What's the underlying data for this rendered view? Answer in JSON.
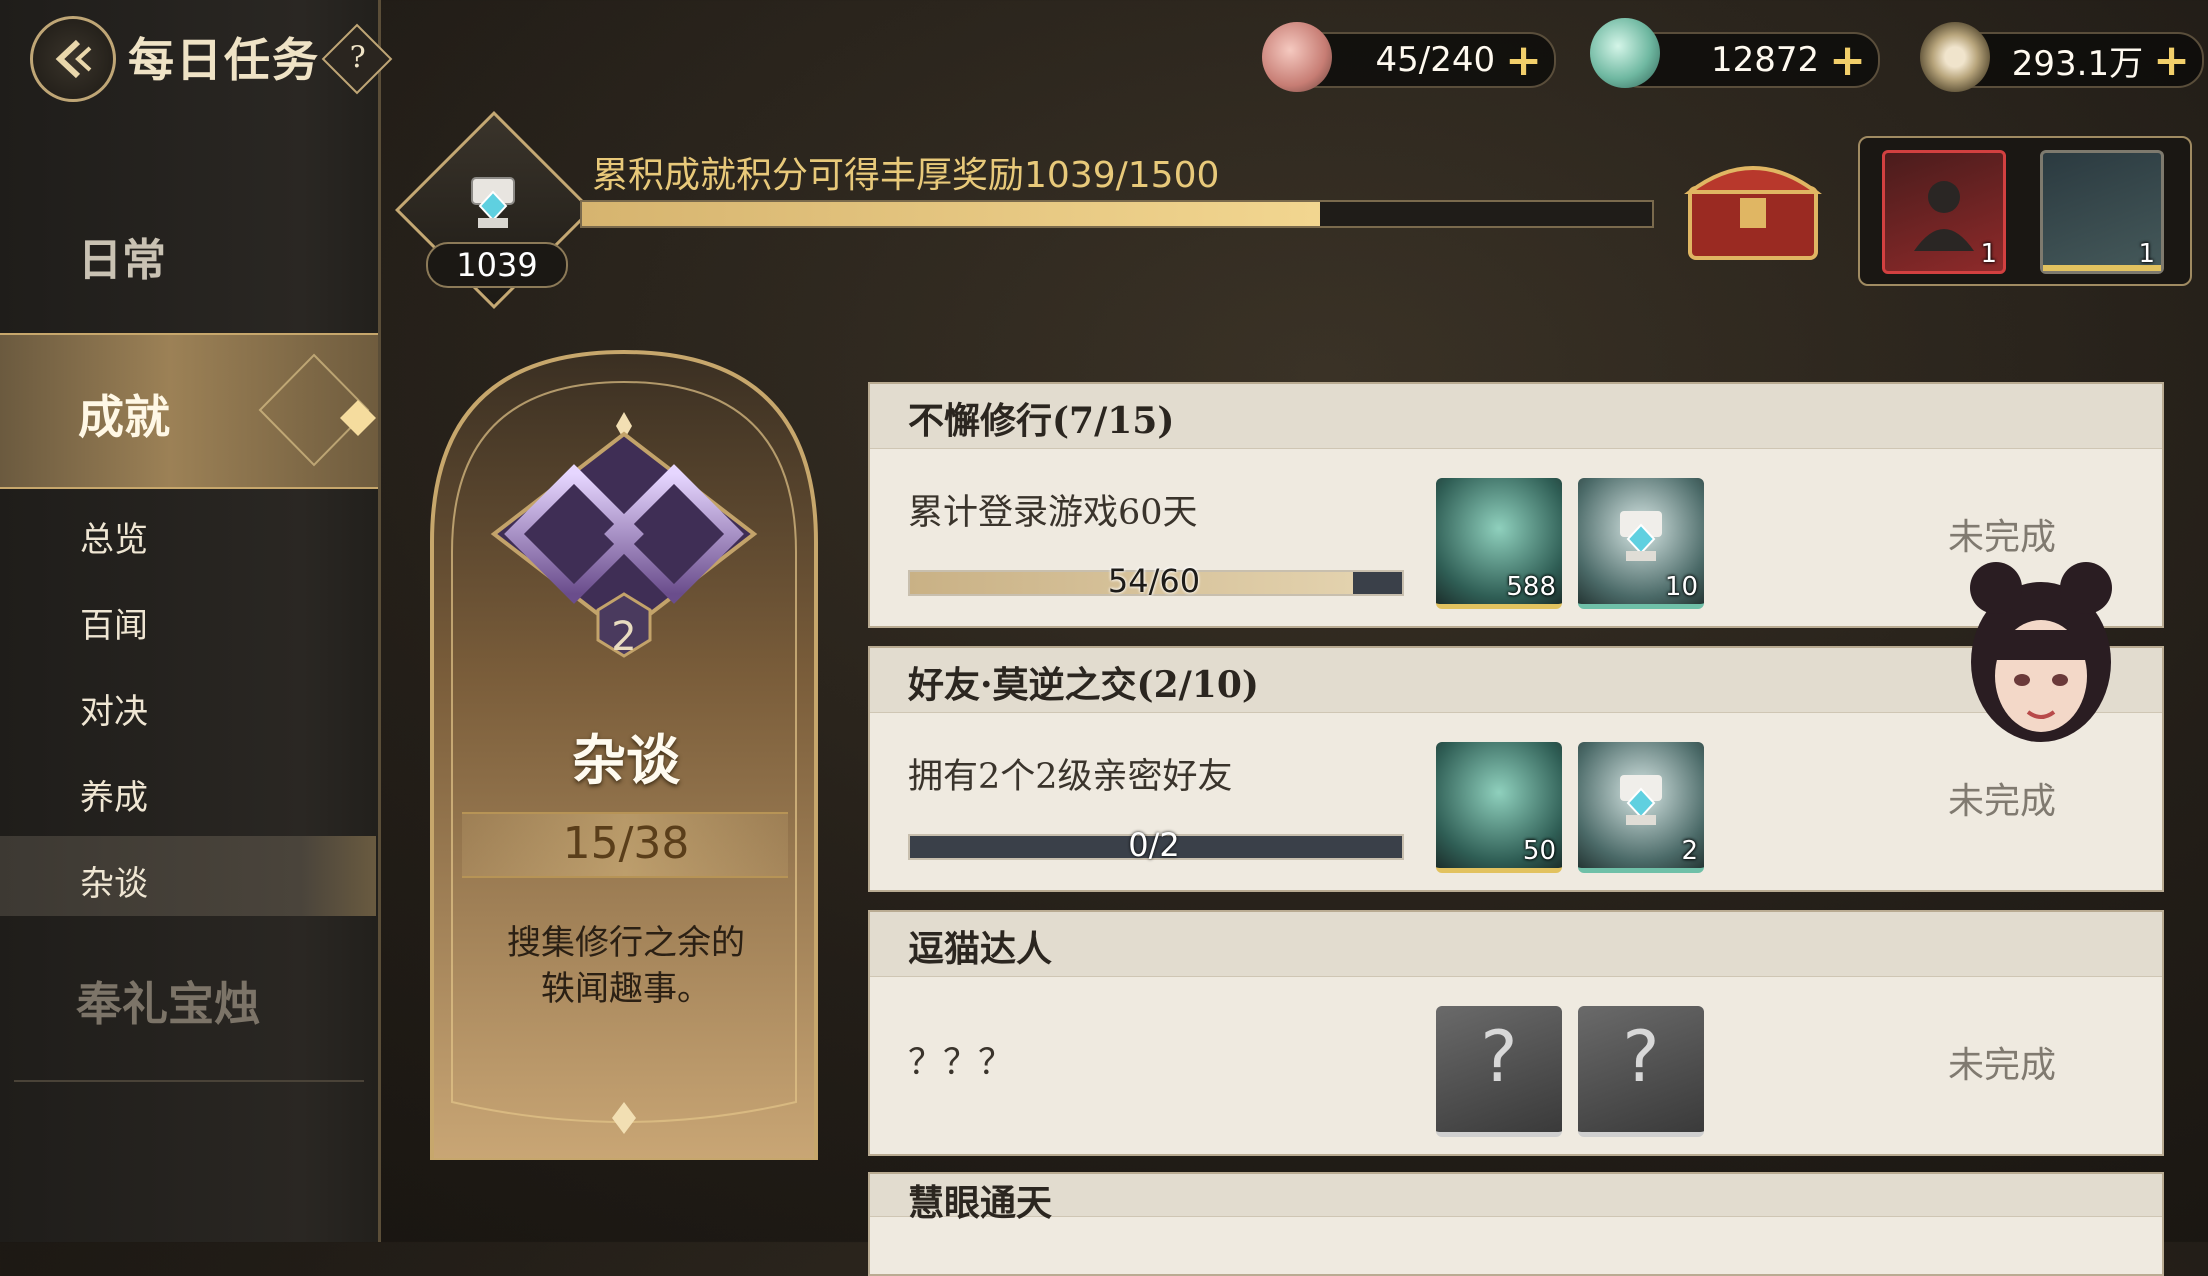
{
  "header": {
    "back_icon": "back-arrow-icon",
    "title": "每日任务",
    "help": "?"
  },
  "resources": [
    {
      "icon": "peach-stamina-icon",
      "value": "45/240",
      "plus": "+"
    },
    {
      "icon": "jade-lotus-icon",
      "value": "12872",
      "plus": "+"
    },
    {
      "icon": "gear-coin-icon",
      "value": "293.1万",
      "plus": "+"
    }
  ],
  "sidebar": {
    "category_daily": "日常",
    "category_achievement": "成就",
    "items": [
      {
        "label": "总览"
      },
      {
        "label": "百闻"
      },
      {
        "label": "对决"
      },
      {
        "label": "养成"
      },
      {
        "label": "杂谈"
      }
    ],
    "active_item": "杂谈",
    "category_gift": "奉礼宝烛"
  },
  "achievement_progress": {
    "score": "1039",
    "title_text": "累积成就积分可得丰厚奖励",
    "title_count": "1039/1500",
    "fraction": 0.69,
    "rewards": [
      {
        "icon": "portrait-frame-icon",
        "count": "1"
      },
      {
        "icon": "banner-card-icon",
        "count": "1"
      }
    ]
  },
  "category_card": {
    "level": "2",
    "name": "杂谈",
    "progress": "15/38",
    "description_line1": "搜集修行之余的",
    "description_line2": "轶闻趣事。"
  },
  "achievements": [
    {
      "title": "不懈修行(7/15)",
      "description": "累计登录游戏60天",
      "progress_text": "54/60",
      "progress_fraction": 0.9,
      "rewards": [
        {
          "icon": "jade-lotus-icon",
          "count": "588"
        },
        {
          "icon": "trophy-cup-icon",
          "count": "10"
        }
      ],
      "status": "未完成"
    },
    {
      "title": "好友·莫逆之交(2/10)",
      "description": "拥有2个2级亲密好友",
      "progress_text": "0/2",
      "progress_fraction": 0,
      "rewards": [
        {
          "icon": "jade-lotus-icon",
          "count": "50"
        },
        {
          "icon": "trophy-cup-icon",
          "count": "2"
        }
      ],
      "status": "未完成"
    },
    {
      "title": "逗猫达人",
      "description": "？？？",
      "rewards": [
        {
          "icon": "unknown-question-icon"
        },
        {
          "icon": "unknown-question-icon"
        }
      ],
      "status": "未完成"
    },
    {
      "title": "慧眼通天"
    }
  ]
}
